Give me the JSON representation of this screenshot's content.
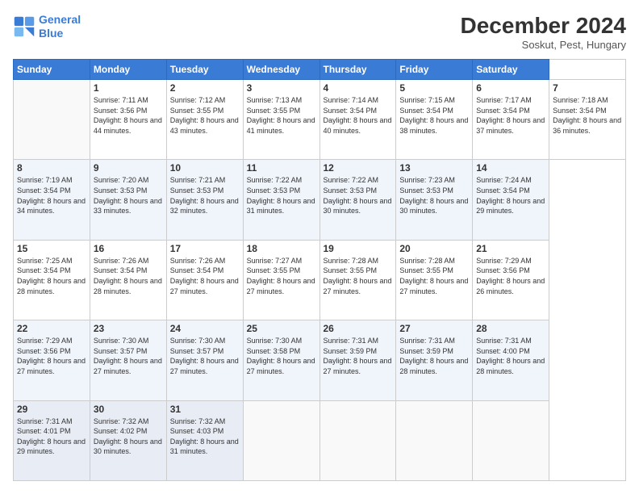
{
  "header": {
    "logo_line1": "General",
    "logo_line2": "Blue",
    "main_title": "December 2024",
    "subtitle": "Soskut, Pest, Hungary"
  },
  "calendar": {
    "days_of_week": [
      "Sunday",
      "Monday",
      "Tuesday",
      "Wednesday",
      "Thursday",
      "Friday",
      "Saturday"
    ],
    "weeks": [
      [
        null,
        {
          "day": 1,
          "sunrise": "7:11 AM",
          "sunset": "3:56 PM",
          "daylight": "8 hours and 44 minutes."
        },
        {
          "day": 2,
          "sunrise": "7:12 AM",
          "sunset": "3:55 PM",
          "daylight": "8 hours and 43 minutes."
        },
        {
          "day": 3,
          "sunrise": "7:13 AM",
          "sunset": "3:55 PM",
          "daylight": "8 hours and 41 minutes."
        },
        {
          "day": 4,
          "sunrise": "7:14 AM",
          "sunset": "3:54 PM",
          "daylight": "8 hours and 40 minutes."
        },
        {
          "day": 5,
          "sunrise": "7:15 AM",
          "sunset": "3:54 PM",
          "daylight": "8 hours and 38 minutes."
        },
        {
          "day": 6,
          "sunrise": "7:17 AM",
          "sunset": "3:54 PM",
          "daylight": "8 hours and 37 minutes."
        },
        {
          "day": 7,
          "sunrise": "7:18 AM",
          "sunset": "3:54 PM",
          "daylight": "8 hours and 36 minutes."
        }
      ],
      [
        {
          "day": 8,
          "sunrise": "7:19 AM",
          "sunset": "3:54 PM",
          "daylight": "8 hours and 34 minutes."
        },
        {
          "day": 9,
          "sunrise": "7:20 AM",
          "sunset": "3:53 PM",
          "daylight": "8 hours and 33 minutes."
        },
        {
          "day": 10,
          "sunrise": "7:21 AM",
          "sunset": "3:53 PM",
          "daylight": "8 hours and 32 minutes."
        },
        {
          "day": 11,
          "sunrise": "7:22 AM",
          "sunset": "3:53 PM",
          "daylight": "8 hours and 31 minutes."
        },
        {
          "day": 12,
          "sunrise": "7:22 AM",
          "sunset": "3:53 PM",
          "daylight": "8 hours and 30 minutes."
        },
        {
          "day": 13,
          "sunrise": "7:23 AM",
          "sunset": "3:53 PM",
          "daylight": "8 hours and 30 minutes."
        },
        {
          "day": 14,
          "sunrise": "7:24 AM",
          "sunset": "3:54 PM",
          "daylight": "8 hours and 29 minutes."
        }
      ],
      [
        {
          "day": 15,
          "sunrise": "7:25 AM",
          "sunset": "3:54 PM",
          "daylight": "8 hours and 28 minutes."
        },
        {
          "day": 16,
          "sunrise": "7:26 AM",
          "sunset": "3:54 PM",
          "daylight": "8 hours and 28 minutes."
        },
        {
          "day": 17,
          "sunrise": "7:26 AM",
          "sunset": "3:54 PM",
          "daylight": "8 hours and 27 minutes."
        },
        {
          "day": 18,
          "sunrise": "7:27 AM",
          "sunset": "3:55 PM",
          "daylight": "8 hours and 27 minutes."
        },
        {
          "day": 19,
          "sunrise": "7:28 AM",
          "sunset": "3:55 PM",
          "daylight": "8 hours and 27 minutes."
        },
        {
          "day": 20,
          "sunrise": "7:28 AM",
          "sunset": "3:55 PM",
          "daylight": "8 hours and 27 minutes."
        },
        {
          "day": 21,
          "sunrise": "7:29 AM",
          "sunset": "3:56 PM",
          "daylight": "8 hours and 26 minutes."
        }
      ],
      [
        {
          "day": 22,
          "sunrise": "7:29 AM",
          "sunset": "3:56 PM",
          "daylight": "8 hours and 27 minutes."
        },
        {
          "day": 23,
          "sunrise": "7:30 AM",
          "sunset": "3:57 PM",
          "daylight": "8 hours and 27 minutes."
        },
        {
          "day": 24,
          "sunrise": "7:30 AM",
          "sunset": "3:57 PM",
          "daylight": "8 hours and 27 minutes."
        },
        {
          "day": 25,
          "sunrise": "7:30 AM",
          "sunset": "3:58 PM",
          "daylight": "8 hours and 27 minutes."
        },
        {
          "day": 26,
          "sunrise": "7:31 AM",
          "sunset": "3:59 PM",
          "daylight": "8 hours and 27 minutes."
        },
        {
          "day": 27,
          "sunrise": "7:31 AM",
          "sunset": "3:59 PM",
          "daylight": "8 hours and 28 minutes."
        },
        {
          "day": 28,
          "sunrise": "7:31 AM",
          "sunset": "4:00 PM",
          "daylight": "8 hours and 28 minutes."
        }
      ],
      [
        {
          "day": 29,
          "sunrise": "7:31 AM",
          "sunset": "4:01 PM",
          "daylight": "8 hours and 29 minutes."
        },
        {
          "day": 30,
          "sunrise": "7:32 AM",
          "sunset": "4:02 PM",
          "daylight": "8 hours and 30 minutes."
        },
        {
          "day": 31,
          "sunrise": "7:32 AM",
          "sunset": "4:03 PM",
          "daylight": "8 hours and 31 minutes."
        },
        null,
        null,
        null,
        null
      ]
    ]
  }
}
